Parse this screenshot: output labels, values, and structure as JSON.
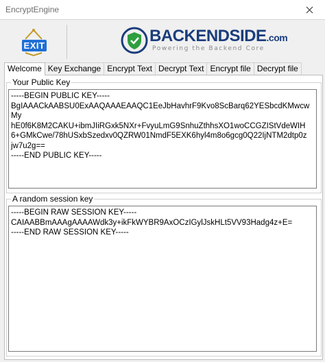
{
  "window": {
    "title": "EncryptEngine"
  },
  "toolbar": {
    "exit_label": "EXIT"
  },
  "logo": {
    "name": "BACKENDSIDE",
    "domain": ".com",
    "tagline": "Powering the Backend Core"
  },
  "tabs": [
    {
      "label": "Welcome"
    },
    {
      "label": "Key Exchange"
    },
    {
      "label": "Encrypt Text"
    },
    {
      "label": "Decrypt Text"
    },
    {
      "label": "Encrypt file"
    },
    {
      "label": "Decrypt file"
    }
  ],
  "public_key": {
    "label": "Your Public Key",
    "value": "-----BEGIN PUBLIC KEY-----\nBgIAAACkAABSU0ExAAQAAAEAAQC1EeJbHavhrF9Kvo8ScBarq62YESbcdKMwcwMy\nhE0f6K8M2CAKU+ibmJIiRGxk5NXr+FvyuLmG9SnhuZthhsXO1woCCGZIStVdeWIH\n6+GMkCwe/78hUSxbSzedxv0QZRW01NmdF5EXK6hyl4m8o6gcg0Q22IjNTM2dtp0z\njw7u2g==\n-----END PUBLIC KEY-----"
  },
  "session_key": {
    "label": "A random session key",
    "value": "-----BEGIN RAW SESSION KEY-----\nCAIAABBmAAAgAAAAWdk3y+ikFkWYBR9AxOCzIGylJskHLt5VV93Hadg4z+E=\n-----END RAW SESSION KEY-----"
  },
  "colors": {
    "accent": "#1f6fd6",
    "brand": "#1a3d7c",
    "shield": "#2e9e3e"
  }
}
